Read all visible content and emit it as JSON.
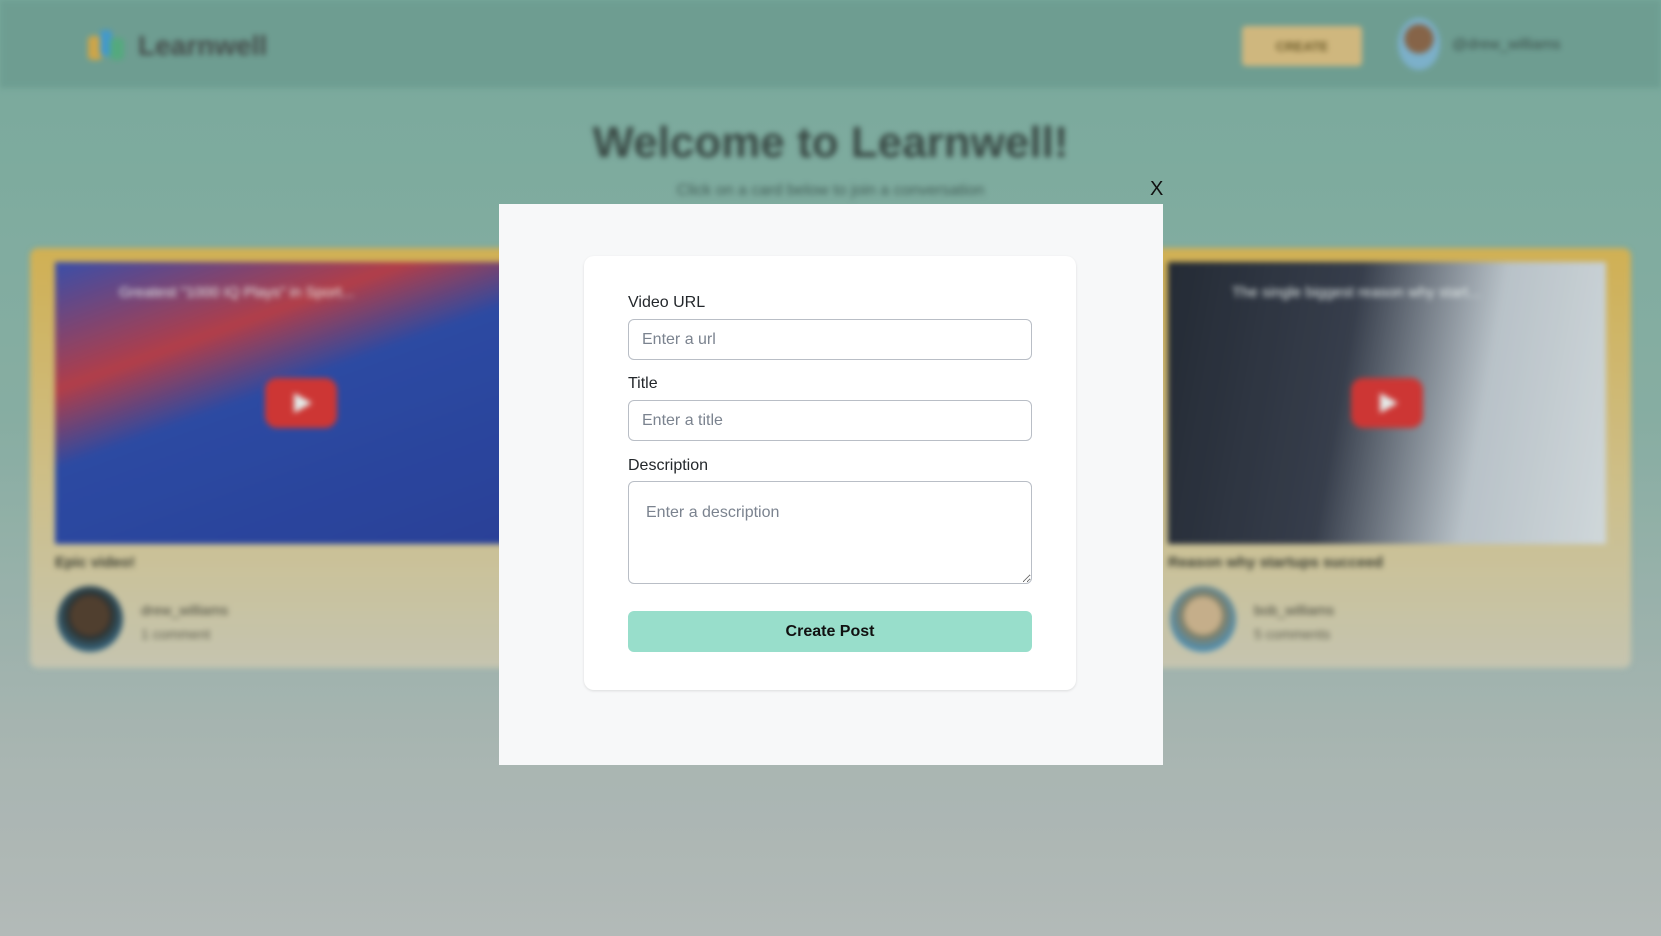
{
  "header": {
    "logo_text": "Learnwell",
    "create_label": "CREATE",
    "username": "@drew_williams"
  },
  "hero": {
    "title": "Welcome to Learnwell!",
    "subtitle": "Click on a card below to join a conversation"
  },
  "cards": [
    {
      "video_title": "Greatest \"1000 IQ Plays\" in Sport...",
      "title": "Epic video!",
      "user": "drew_williams",
      "comments": "1 comment"
    },
    {
      "video_title": "The single biggest reason why start...",
      "title": "Reason why startups succeed",
      "user": "bob_williams",
      "comments": "5 comments"
    }
  ],
  "modal": {
    "close_label": "X",
    "url_label": "Video URL",
    "url_placeholder": "Enter a url",
    "title_label": "Title",
    "title_placeholder": "Enter a title",
    "description_label": "Description",
    "description_placeholder": "Enter a description",
    "submit_label": "Create Post"
  }
}
